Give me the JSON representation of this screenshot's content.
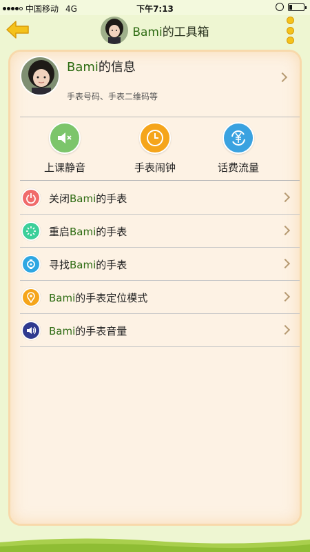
{
  "status_bar": {
    "carrier": "中国移动",
    "network": "4G",
    "time": "下午7:13"
  },
  "header": {
    "title_name": "Bami",
    "title_suffix": "的工具箱",
    "back_icon": "back-arrow-icon",
    "more_icon": "more-vertical-icon"
  },
  "profile": {
    "name_prefix": "Bami",
    "name_suffix": "的信息",
    "subtitle": "手表号码、手表二维码等"
  },
  "quick_actions": [
    {
      "label": "上课静音",
      "icon": "mute-icon",
      "color": "#7cc56b"
    },
    {
      "label": "手表闹钟",
      "icon": "alarm-clock-icon",
      "color": "#f5a51b"
    },
    {
      "label": "话费流量",
      "icon": "yuan-refresh-icon",
      "color": "#3aa2e0"
    }
  ],
  "menu": [
    {
      "prefix": "关闭",
      "name": "Bami",
      "suffix": "的手表",
      "icon": "power-icon",
      "color": "#f06b6b"
    },
    {
      "prefix": "重启",
      "name": "Bami",
      "suffix": "的手表",
      "icon": "restart-icon",
      "color": "#3ccf9a"
    },
    {
      "prefix": "寻找",
      "name": "Bami",
      "suffix": "的手表",
      "icon": "find-watch-icon",
      "color": "#2fa7e2"
    },
    {
      "prefix": "",
      "name": "Bami",
      "suffix": "的手表定位模式",
      "icon": "location-icon",
      "color": "#f5a51b"
    },
    {
      "prefix": "",
      "name": "Bami",
      "suffix": "的手表音量",
      "icon": "volume-icon",
      "color": "#2f3a8f"
    }
  ],
  "colors": {
    "background": "#eef6d2",
    "card": "#fdf2e4",
    "accent_green": "#2d6b12",
    "accent_yellow": "#f4c21b"
  }
}
